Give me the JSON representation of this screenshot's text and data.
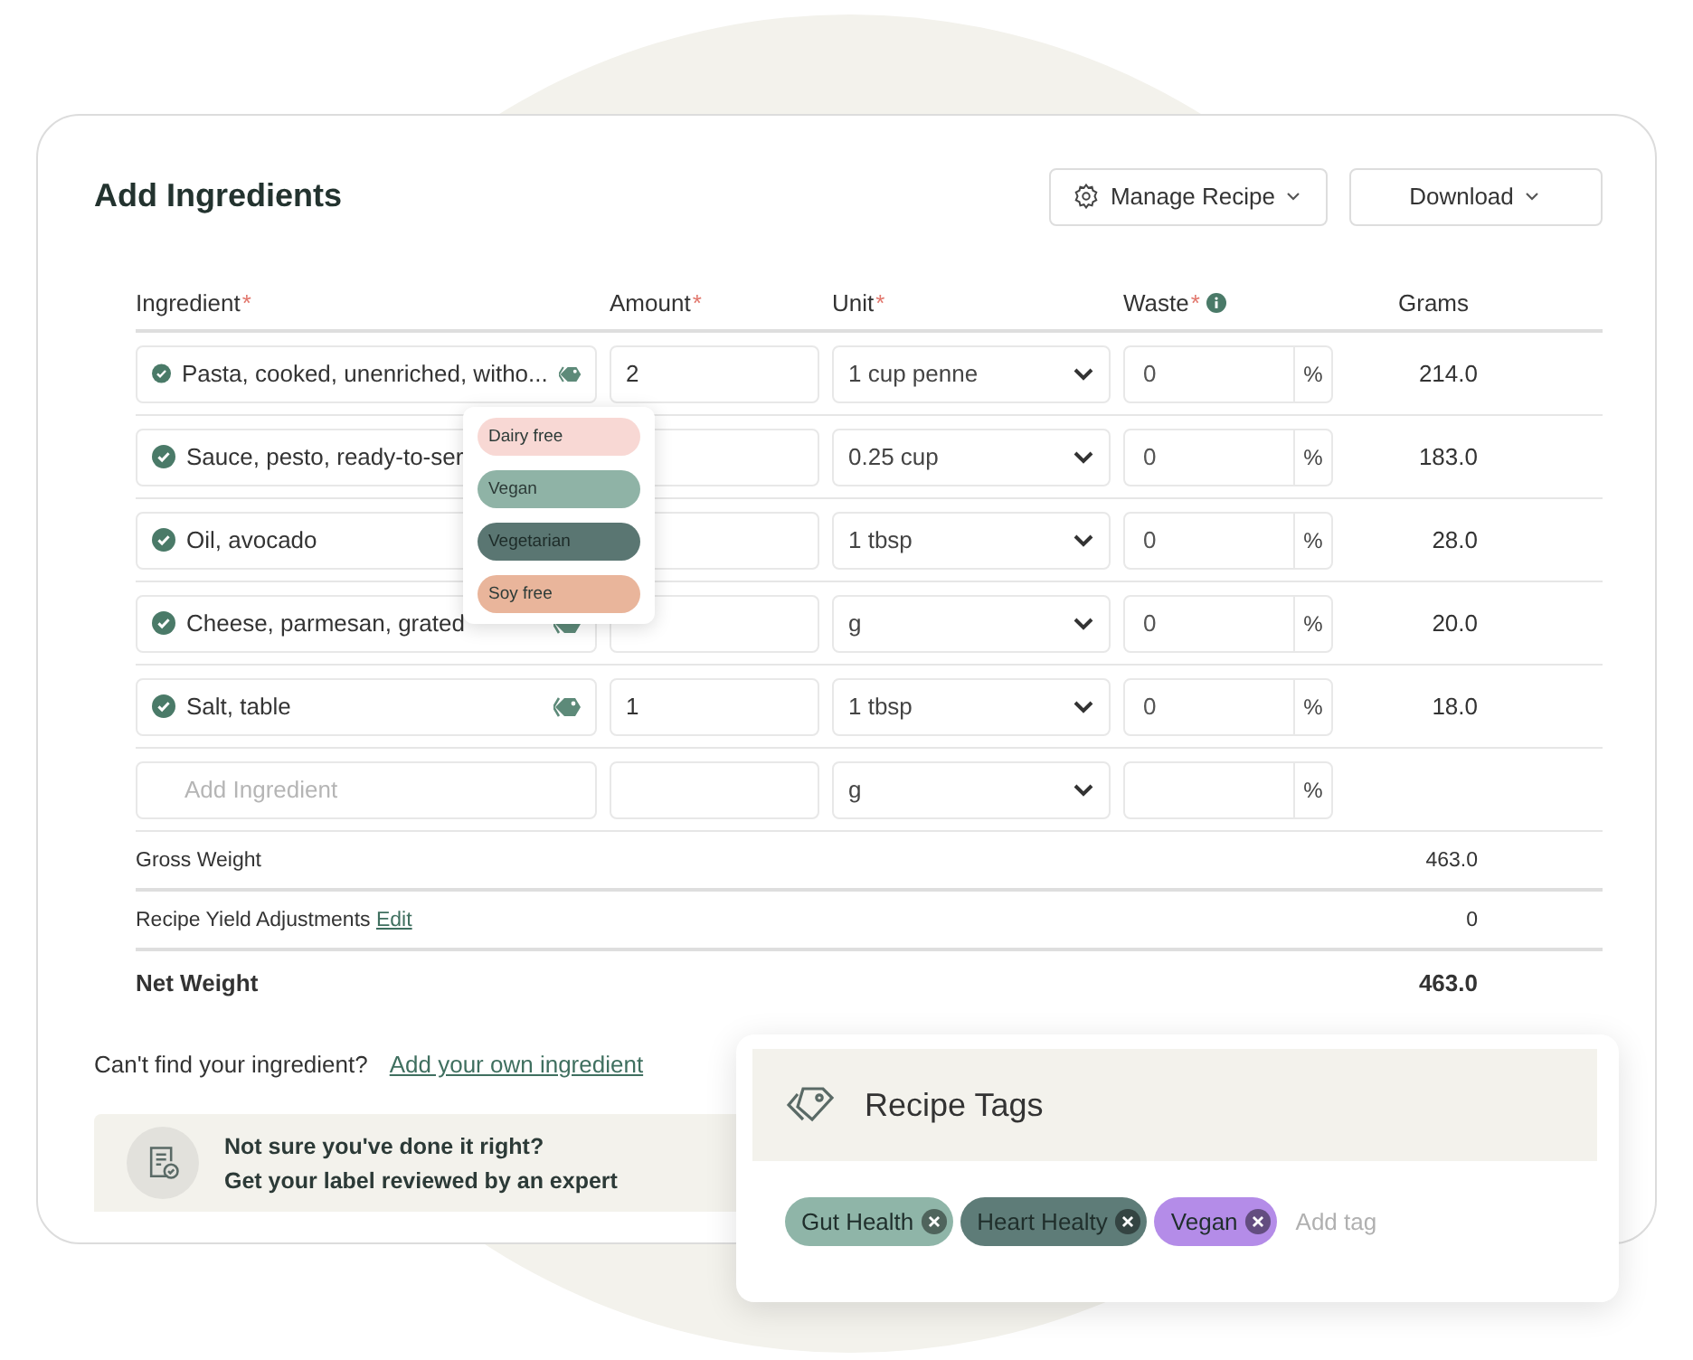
{
  "header": {
    "title": "Add Ingredients",
    "buttons": [
      {
        "label": "Manage Recipe",
        "kind": "gear"
      },
      {
        "label": "Download",
        "kind": "plain"
      }
    ]
  },
  "table": {
    "columns": [
      {
        "label": "Ingredient",
        "required_mark": "*"
      },
      {
        "label": "Amount",
        "required_mark": "*"
      },
      {
        "label": "Unit",
        "required_mark": "*"
      },
      {
        "label": "Waste",
        "required_mark": "*",
        "info": true
      },
      {
        "label": "Grams"
      }
    ],
    "rows": [
      {
        "ingredient": "Pasta, cooked, unenriched, witho...",
        "verified": true,
        "tagged": true,
        "amount": "2",
        "unit": "1 cup penne",
        "waste": "0",
        "waste_unit": "%",
        "grams": "214.0"
      },
      {
        "ingredient": "Sauce, pesto, ready-to-ser",
        "verified": true,
        "unit": "0.25 cup",
        "waste": "0",
        "waste_unit": "%",
        "grams": "183.0"
      },
      {
        "ingredient": "Oil, avocado",
        "verified": true,
        "unit": "1 tbsp",
        "waste": "0",
        "waste_unit": "%",
        "grams": "28.0"
      },
      {
        "ingredient": "Cheese, parmesan, grated",
        "verified": true,
        "tagged": true,
        "unit": "g",
        "waste": "0",
        "waste_unit": "%",
        "grams": "20.0"
      },
      {
        "ingredient": "Salt, table",
        "verified": true,
        "tagged": true,
        "amount": "1",
        "unit": "1 tbsp",
        "waste": "0",
        "waste_unit": "%",
        "grams": "18.0"
      }
    ],
    "new_row": {
      "placeholder": "Add Ingredient",
      "unit": "g",
      "waste_unit": "%"
    },
    "totals": [
      {
        "label": "Gross Weight",
        "value": "463.0",
        "bold": false
      },
      {
        "label": "Recipe Yield Adjustments",
        "link": "Edit",
        "value": "0",
        "bold": false
      },
      {
        "label": "Net Weight",
        "value": "463.0",
        "bold": true
      }
    ]
  },
  "tag_popup": {
    "options": [
      {
        "label": "Dairy free",
        "color": "#f8d8d4"
      },
      {
        "label": "Vegan",
        "color": "#8fb3a6"
      },
      {
        "label": "Vegetarian",
        "color": "#5a7672"
      },
      {
        "label": "Soy free",
        "color": "#e9b59b"
      }
    ]
  },
  "footer": {
    "prompt": "Can't find your ingredient?",
    "link": "Add your own ingredient"
  },
  "review_banner": {
    "lines": [
      "Not sure you've done it right?",
      "Get your label reviewed by an expert"
    ]
  },
  "recipe_tags": {
    "title": "Recipe Tags",
    "placeholder": "Add tag",
    "tags": [
      {
        "label": "Gut Health",
        "color": "#8fb5a8"
      },
      {
        "label": "Heart Healty",
        "color": "#5e7c78"
      },
      {
        "label": "Vegan",
        "color": "#b48ce8"
      }
    ]
  }
}
